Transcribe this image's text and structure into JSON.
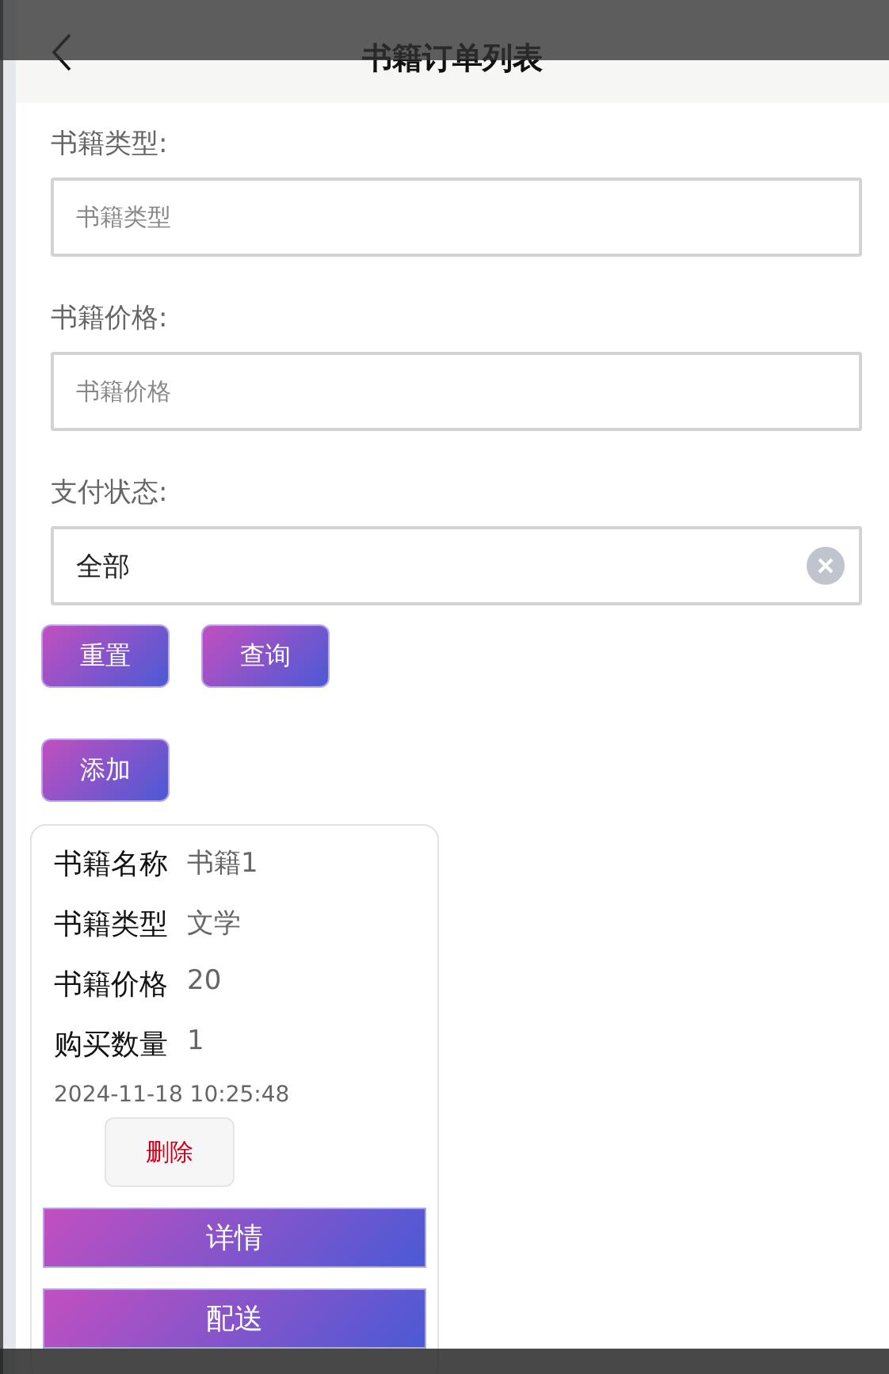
{
  "header": {
    "title": "书籍订单列表"
  },
  "filters": [
    {
      "kind": "input",
      "label": "书籍类型:",
      "placeholder": "书籍类型"
    },
    {
      "kind": "input",
      "label": "书籍价格:",
      "placeholder": "书籍价格"
    },
    {
      "kind": "select",
      "label": "支付状态:",
      "value": "全部"
    }
  ],
  "search_buttons": [
    "重置",
    "查询"
  ],
  "add_button": "添加",
  "orders": [
    {
      "fields": [
        {
          "label": "书籍名称",
          "value": "书籍1"
        },
        {
          "label": "书籍类型",
          "value": "文学"
        },
        {
          "label": "书籍价格",
          "value": "20"
        },
        {
          "label": "购买数量",
          "value": "1"
        }
      ],
      "time": "2024-11-18 10:25:48",
      "delete": "删除",
      "actions": [
        "详情",
        "配送"
      ]
    }
  ]
}
